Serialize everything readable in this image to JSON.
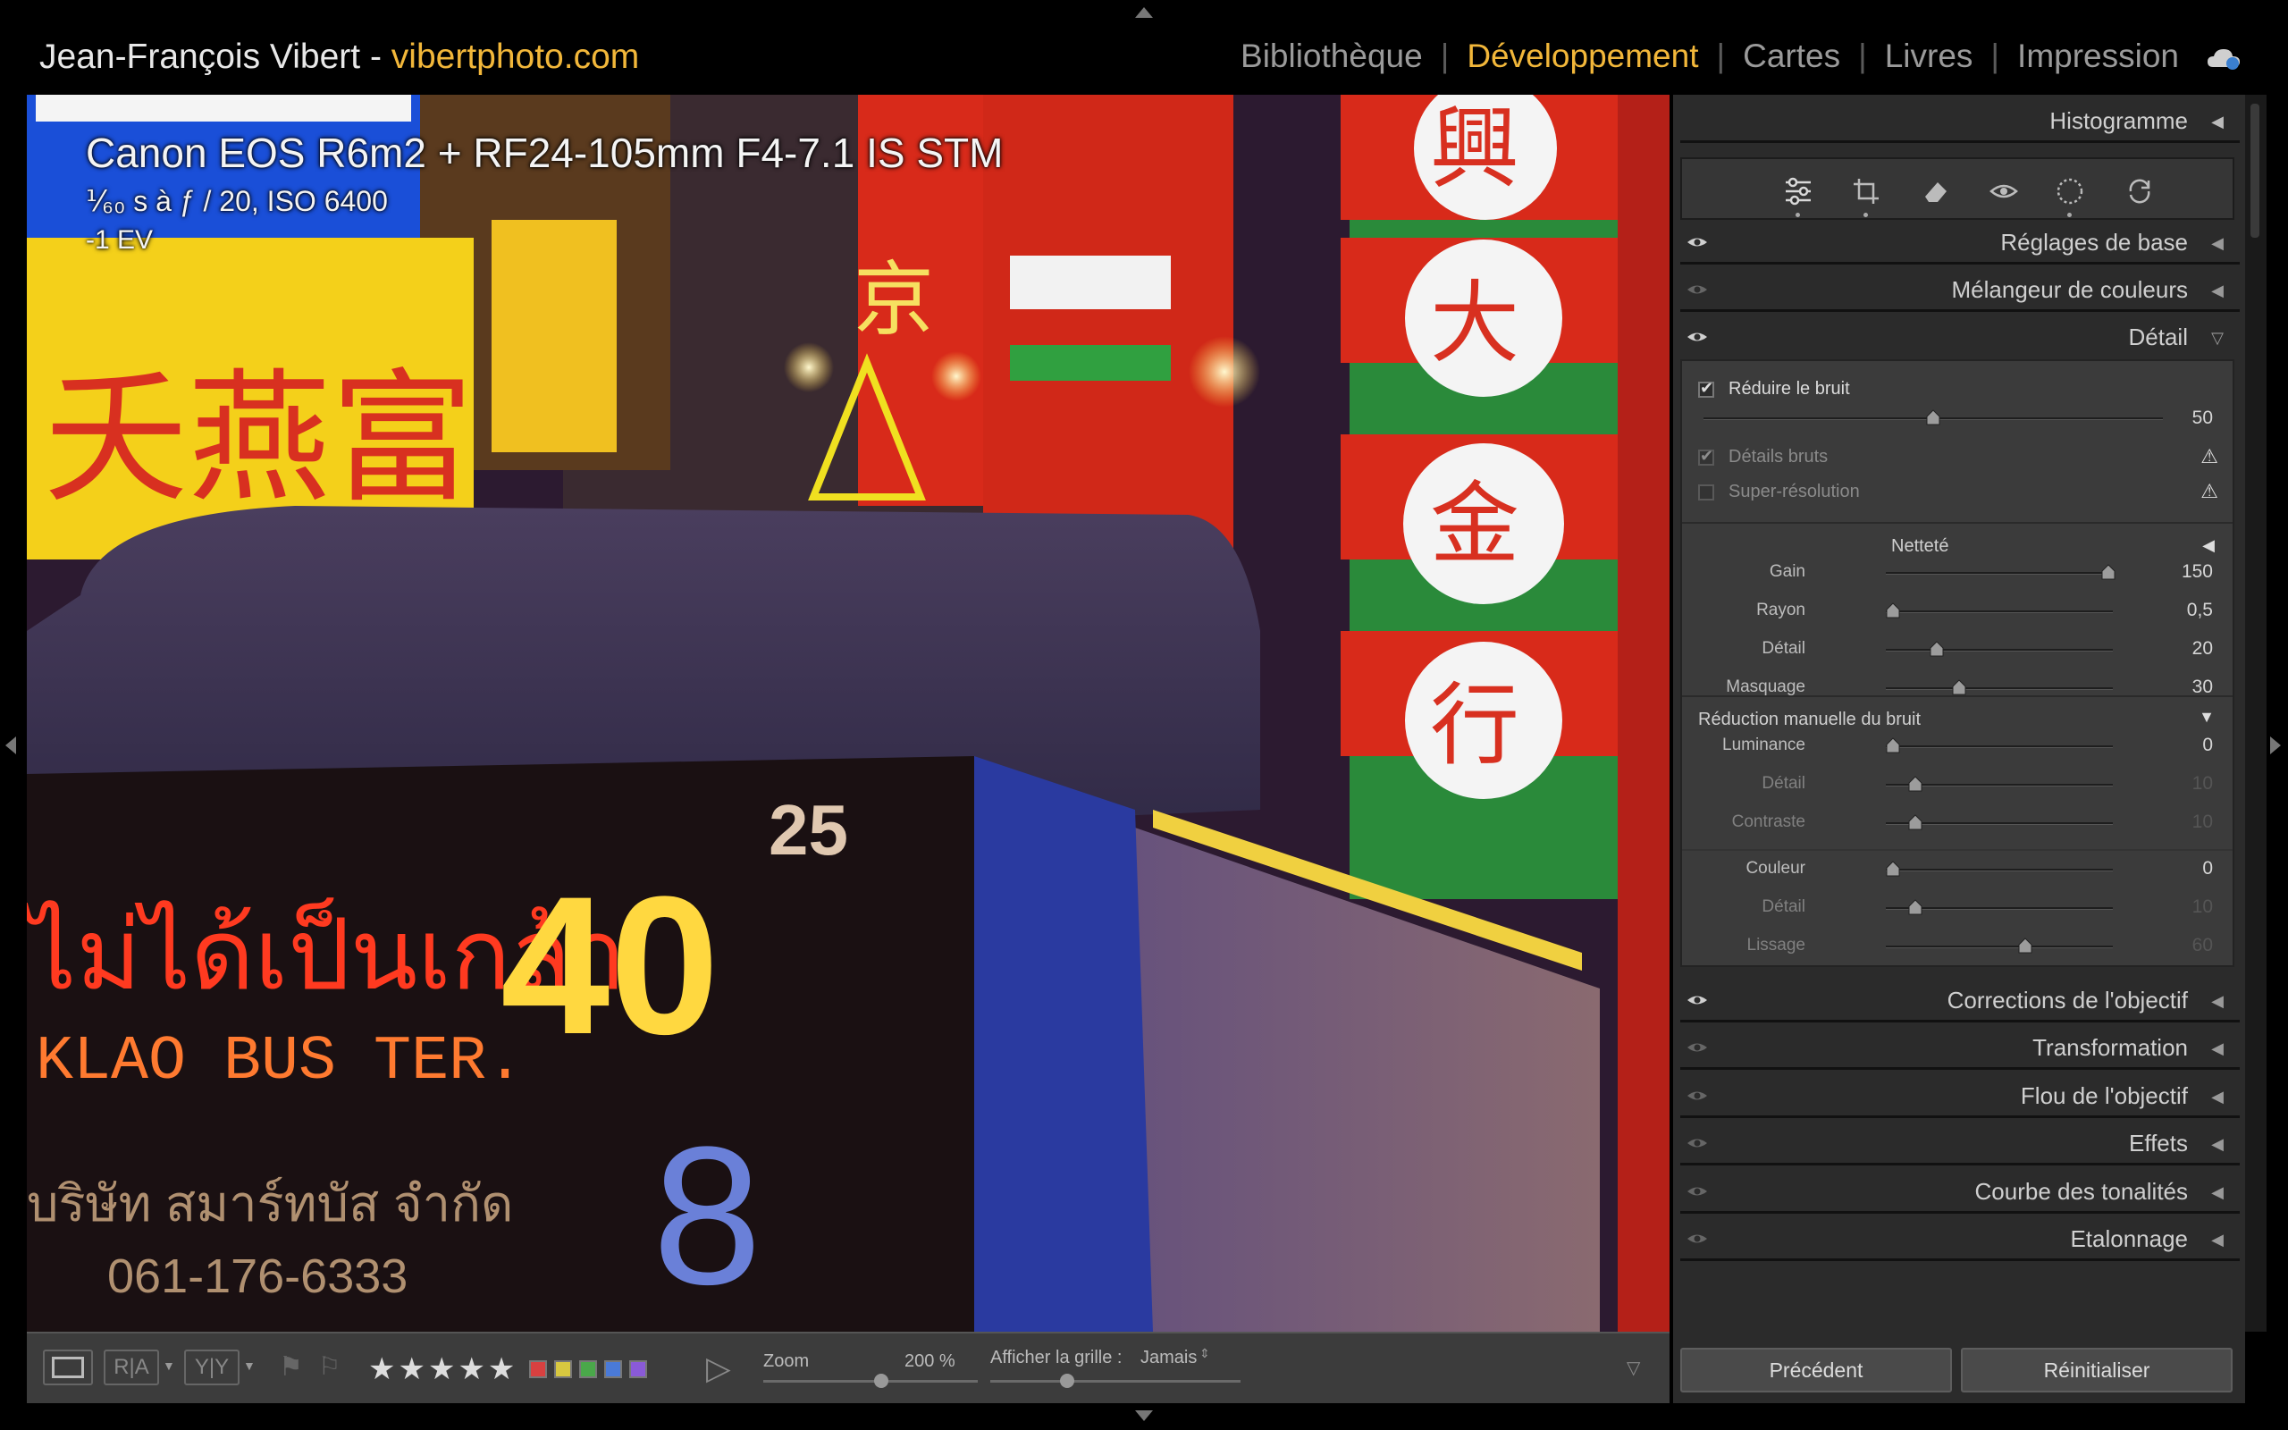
{
  "header": {
    "owner": "Jean-François Vibert - ",
    "site": "vibertphoto.com",
    "modules": [
      "Bibliothèque",
      "Développement",
      "Cartes",
      "Livres",
      "Impression"
    ],
    "active_module": "Développement"
  },
  "photo_info": {
    "camera": "Canon EOS R6m2 + RF24-105mm F4-7.1 IS STM",
    "exposure": "⅟₆₀ s à ƒ / 20, ISO 6400",
    "ev": "-1 EV"
  },
  "toolbar": {
    "stars": "★★★★★",
    "color_labels": [
      "#d84040",
      "#d8c840",
      "#4aa84a",
      "#4a7ad8",
      "#8a5ad8"
    ],
    "zoom_label": "Zoom",
    "zoom_value": "200 %",
    "zoom_level": 0.55,
    "grid_label": "Afficher la grille :",
    "grid_value": "Jamais",
    "view_btns": [
      "R|A",
      "Y|Y"
    ]
  },
  "panel": {
    "histogram": "Histogramme",
    "sections_top": [
      "Réglages de base",
      "Mélangeur de couleurs",
      "Détail"
    ],
    "denoise": {
      "label": "Réduire le bruit",
      "value": "50",
      "level": 0.5,
      "raw_details": "Détails bruts",
      "super_res": "Super-résolution"
    },
    "sharpening": {
      "title": "Netteté",
      "rows": [
        {
          "label": "Gain",
          "value": "150",
          "level": 0.98
        },
        {
          "label": "Rayon",
          "value": "0,5",
          "level": 0.0
        },
        {
          "label": "Détail",
          "value": "20",
          "level": 0.2
        },
        {
          "label": "Masquage",
          "value": "30",
          "level": 0.3
        }
      ]
    },
    "manual_nr": {
      "title": "Réduction manuelle du bruit",
      "luminance": [
        {
          "label": "Luminance",
          "value": "0",
          "level": 0.0,
          "disabled": false
        },
        {
          "label": "Détail",
          "value": "10",
          "level": 0.1,
          "disabled": true
        },
        {
          "label": "Contraste",
          "value": "10",
          "level": 0.1,
          "disabled": true
        }
      ],
      "color": [
        {
          "label": "Couleur",
          "value": "0",
          "level": 0.0,
          "disabled": false
        },
        {
          "label": "Détail",
          "value": "10",
          "level": 0.1,
          "disabled": true
        },
        {
          "label": "Lissage",
          "value": "60",
          "level": 0.6,
          "disabled": true
        }
      ]
    },
    "sections_bottom": [
      "Corrections de l'objectif",
      "Transformation",
      "Flou de l'objectif",
      "Effets",
      "Courbe des tonalités",
      "Etalonnage"
    ],
    "buttons": {
      "previous": "Précédent",
      "reset": "Réinitialiser"
    }
  }
}
